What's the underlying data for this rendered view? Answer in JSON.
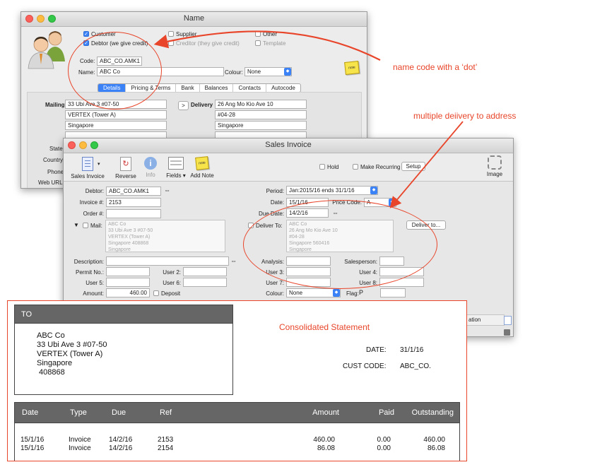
{
  "name_window": {
    "title": "Name",
    "checkboxes": {
      "customer": {
        "label": "Customer",
        "checked": true
      },
      "debtor": {
        "label": "Debtor (we give credit)",
        "checked": true
      },
      "supplier": {
        "label": "Supplier",
        "checked": false
      },
      "creditor": {
        "label": "Creditor (they give credit)",
        "checked": false
      },
      "other": {
        "label": "Other",
        "checked": false
      },
      "template": {
        "label": "Template",
        "checked": false
      }
    },
    "code_label": "Code:",
    "code_value": "ABC_CO.AMK1",
    "name_label": "Name:",
    "name_value": "ABC Co",
    "colour_label": "Colour:",
    "colour_value": "None",
    "tabs": [
      "Details",
      "Pricing & Terms",
      "Bank",
      "Balances",
      "Contacts",
      "Autocode"
    ],
    "active_tab": "Details",
    "mailing_label": "Mailing",
    "mailing_lines": [
      "33 Ubi Ave 3 #07-50",
      "VERTEX (Tower A)",
      "Singapore",
      ""
    ],
    "delivery_button": ">",
    "delivery_label": "Delivery",
    "delivery_lines": [
      "26 Ang Mo Kio Ave 10",
      "#04-28",
      "Singapore",
      ""
    ],
    "side_labels": [
      "State",
      "Country",
      "Phone",
      "Web URL:"
    ]
  },
  "invoice_window": {
    "title": "Sales Invoice",
    "toolbar": {
      "sales_invoice": "Sales Invoice",
      "reverse": "Reverse",
      "info": "Info",
      "fields": "Fields",
      "add_note": "Add Note",
      "image": "Image"
    },
    "hold_label": "Hold",
    "recurring_label": "Make Recurring",
    "setup_label": "Setup",
    "debtor_label": "Debtor:",
    "debtor_value": "ABC_CO.AMK1",
    "invoice_label": "Invoice #:",
    "invoice_value": "2153",
    "order_label": "Order #:",
    "order_value": "",
    "period_label": "Period:",
    "period_value": "Jan:2015/16 ends 31/1/16",
    "date_label": "Date:",
    "date_value": "15/1/16",
    "price_code_label": "Price Code:",
    "price_code_value": "A",
    "due_label": "Due Date:",
    "due_value": "14/2/16",
    "mail_label": "Mail:",
    "mail_lines": [
      "ABC Co",
      "33 Ubi Ave 3 #07-50",
      "VERTEX (Tower A)",
      "Singapore 408868",
      "Singapore"
    ],
    "deliver_to_label": "Deliver To:",
    "deliver_lines": [
      "ABC Co",
      "26 Ang Mo Kio Ave 10",
      "#04-28",
      "Singapore 560416",
      "Singapore"
    ],
    "deliver_to_button": "Deliver to...",
    "description_label": "Description:",
    "analysis_label": "Analysis:",
    "salesperson_label": "Salesperson:",
    "permit_label": "Permit No.:",
    "user2_label": "User 2:",
    "user3_label": "User 3:",
    "user4_label": "User 4:",
    "user5_label": "User 5:",
    "user6_label": "User 6:",
    "user7_label": "User 7:",
    "user8_label": "User 8:",
    "amount_label": "Amount:",
    "amount_value": "460.00",
    "deposit_label": "Deposit",
    "colour_label": "Colour:",
    "colour_value": "None",
    "flag_label": "Flag:",
    "flag_glyph": "P",
    "partial_column": "ation"
  },
  "annotations": {
    "name_code": "name code with a ‘dot’",
    "multiple_delivery": "multiple deiivery to address",
    "consolidated": "Consolidated Statement"
  },
  "statement": {
    "to_label": "TO",
    "address_lines": [
      "ABC Co",
      "33 Ubi Ave 3 #07-50",
      "VERTEX (Tower A)",
      "Singapore",
      " 408868"
    ],
    "date_label": "DATE:",
    "date_value": "31/1/16",
    "cust_code_label": "CUST CODE:",
    "cust_code_value": "ABC_CO.",
    "columns": [
      "Date",
      "Type",
      "Due",
      "Ref",
      "Amount",
      "Paid",
      "Outstanding"
    ],
    "rows": [
      [
        "15/1/16",
        "Invoice",
        "14/2/16",
        "2153",
        "460.00",
        "0.00",
        "460.00"
      ],
      [
        "15/1/16",
        "Invoice",
        "14/2/16",
        "2154",
        "86.08",
        "0.00",
        "86.08"
      ]
    ]
  },
  "colors": {
    "accent": "#3b82f6",
    "annotation": "#e8452a",
    "header_bar": "#666666"
  }
}
